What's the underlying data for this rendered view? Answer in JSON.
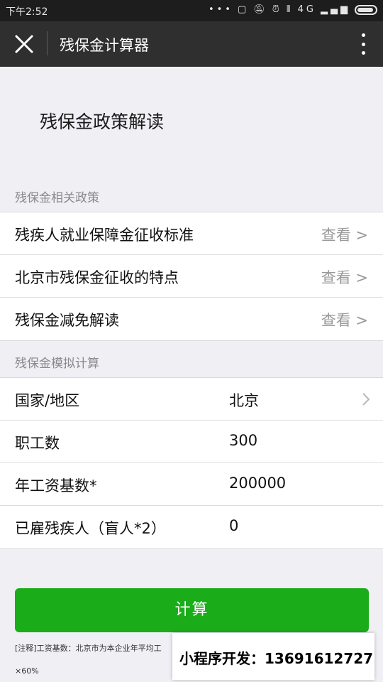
{
  "status_bar": {
    "time": "下午2:52",
    "icons": [
      "more-dots-icon",
      "screen-icon",
      "mute-icon",
      "alarm-icon",
      "vibrate-icon",
      "signal-4g-icon",
      "signal-icon",
      "battery-icon"
    ],
    "network": "4G"
  },
  "title_bar": {
    "title": "残保金计算器",
    "close_icon": "close-icon",
    "more_icon": "more-vertical-icon"
  },
  "page": {
    "heading": "残保金政策解读"
  },
  "policy_section": {
    "label": "残保金相关政策",
    "items": [
      {
        "label": "残疾人就业保障金征收标准",
        "action": "查看 >"
      },
      {
        "label": "北京市残保金征收的特点",
        "action": "查看 >"
      },
      {
        "label": "残保金减免解读",
        "action": "查看 >"
      }
    ]
  },
  "calc_section": {
    "label": "残保金模拟计算",
    "fields": [
      {
        "label": "国家/地区",
        "value": "北京"
      },
      {
        "label": "职工数",
        "value": "300"
      },
      {
        "label": "年工资基数*",
        "value": "200000"
      },
      {
        "label": "已雇残疾人（盲人*2）",
        "value": "0"
      }
    ]
  },
  "calc_button": {
    "label": "计算"
  },
  "note": {
    "line1": "[注释]工资基数：北京市为本企业年平均工",
    "line2": "×60%"
  },
  "promo": {
    "text": "小程序开发：13691612727"
  },
  "colors": {
    "primary_green": "#1aad19",
    "title_bar": "#2f2f2f",
    "background": "#efeff4"
  }
}
